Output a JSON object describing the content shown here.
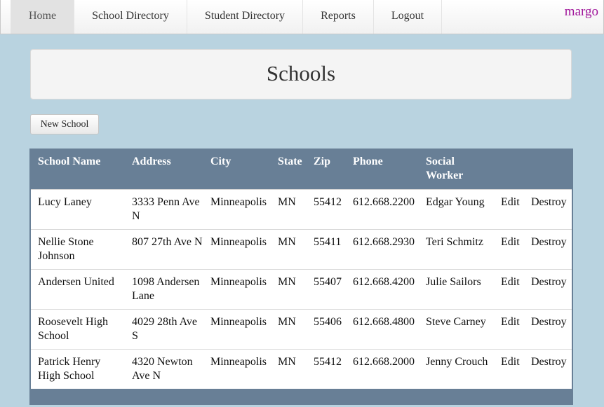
{
  "nav": {
    "items": [
      {
        "label": "Home",
        "active": true
      },
      {
        "label": "School Directory"
      },
      {
        "label": "Student Directory"
      },
      {
        "label": "Reports"
      },
      {
        "label": "Logout"
      }
    ],
    "brand": "margo"
  },
  "page": {
    "title": "Schools",
    "new_button": "New School"
  },
  "table": {
    "headers": [
      "School Name",
      "Address",
      "City",
      "State",
      "Zip",
      "Phone",
      "Social Worker",
      "",
      ""
    ],
    "rows": [
      {
        "name": "Lucy Laney",
        "address": "3333 Penn Ave N",
        "city": "Minneapolis",
        "state": "MN",
        "zip": "55412",
        "phone": "612.668.2200",
        "social_worker": "Edgar Young",
        "edit": "Edit",
        "destroy": "Destroy"
      },
      {
        "name": "Nellie Stone Johnson",
        "address": "807 27th Ave N",
        "city": "Minneapolis",
        "state": "MN",
        "zip": "55411",
        "phone": "612.668.2930",
        "social_worker": "Teri Schmitz",
        "edit": "Edit",
        "destroy": "Destroy"
      },
      {
        "name": "Andersen United",
        "address": "1098 Andersen Lane",
        "city": "Minneapolis",
        "state": "MN",
        "zip": "55407",
        "phone": "612.668.4200",
        "social_worker": "Julie Sailors",
        "edit": "Edit",
        "destroy": "Destroy"
      },
      {
        "name": "Roosevelt High School",
        "address": "4029 28th Ave S",
        "city": "Minneapolis",
        "state": "MN",
        "zip": "55406",
        "phone": "612.668.4800",
        "social_worker": "Steve Carney",
        "edit": "Edit",
        "destroy": "Destroy"
      },
      {
        "name": "Patrick Henry High School",
        "address": "4320 Newton Ave N",
        "city": "Minneapolis",
        "state": "MN",
        "zip": "55412",
        "phone": "612.668.2000",
        "social_worker": "Jenny Crouch",
        "edit": "Edit",
        "destroy": "Destroy"
      }
    ]
  }
}
